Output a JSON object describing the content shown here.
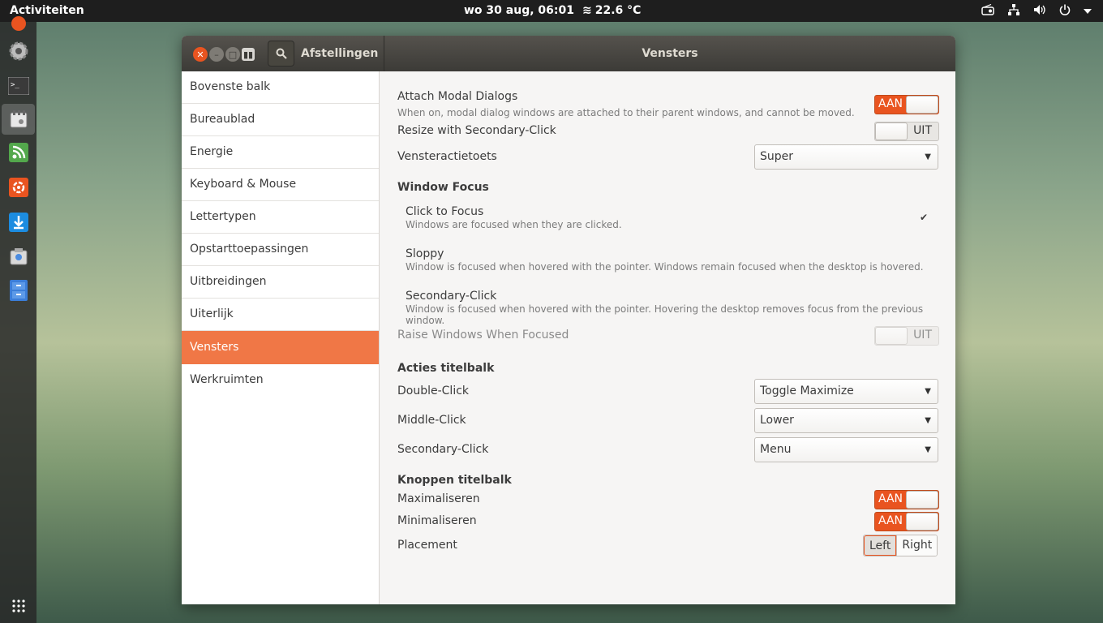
{
  "topbar": {
    "activities": "Activiteiten",
    "clock": "wo 30 aug, 06:01",
    "weather_icon": "≋",
    "weather": "22.6 °C",
    "tray_icons": [
      "radio-icon",
      "network-icon",
      "volume-icon",
      "power-icon",
      "chevron-down-icon"
    ]
  },
  "dock": {
    "items": [
      "settings-icon",
      "terminal-icon",
      "tweaks-icon",
      "rss-icon",
      "ubuntu-software-icon",
      "download-icon",
      "screenshot-icon",
      "file-cabinet-icon",
      "app-grid-icon"
    ]
  },
  "window": {
    "app_title": "Afstellingen",
    "page_title": "Vensters",
    "sidebar": [
      {
        "label": "Bovenste balk"
      },
      {
        "label": "Bureaublad"
      },
      {
        "label": "Energie"
      },
      {
        "label": "Keyboard & Mouse"
      },
      {
        "label": "Lettertypen"
      },
      {
        "label": "Opstarttoepassingen"
      },
      {
        "label": "Uitbreidingen"
      },
      {
        "label": "Uiterlijk"
      },
      {
        "label": "Vensters",
        "selected": true
      },
      {
        "label": "Werkruimten"
      }
    ]
  },
  "content": {
    "attach_modal": {
      "label": "Attach Modal Dialogs",
      "desc": "When on, modal dialog windows are attached to their parent windows, and cannot be moved.",
      "state": "AAN"
    },
    "resize_secondary": {
      "label": "Resize with Secondary-Click",
      "state": "UIT"
    },
    "action_key": {
      "label": "Vensteractietoets",
      "value": "Super"
    },
    "window_focus": {
      "heading": "Window Focus",
      "options": [
        {
          "label": "Click to Focus",
          "desc": "Windows are focused when they are clicked.",
          "checked": true
        },
        {
          "label": "Sloppy",
          "desc": "Window is focused when hovered with the pointer. Windows remain focused when the desktop is hovered."
        },
        {
          "label": "Secondary-Click",
          "desc": "Window is focused when hovered with the pointer. Hovering the desktop removes focus from the previous window."
        }
      ],
      "check_mark": "✔"
    },
    "raise_focused": {
      "label": "Raise Windows When Focused",
      "state": "UIT"
    },
    "titlebar_actions": {
      "heading": "Acties titelbalk",
      "double_click": {
        "label": "Double-Click",
        "value": "Toggle Maximize"
      },
      "middle_click": {
        "label": "Middle-Click",
        "value": "Lower"
      },
      "secondary_click": {
        "label": "Secondary-Click",
        "value": "Menu"
      }
    },
    "titlebar_buttons": {
      "heading": "Knoppen titelbalk",
      "maximize": {
        "label": "Maximaliseren",
        "state": "AAN"
      },
      "minimize": {
        "label": "Minimaliseren",
        "state": "AAN"
      },
      "placement": {
        "label": "Placement",
        "left": "Left",
        "right": "Right"
      }
    }
  }
}
